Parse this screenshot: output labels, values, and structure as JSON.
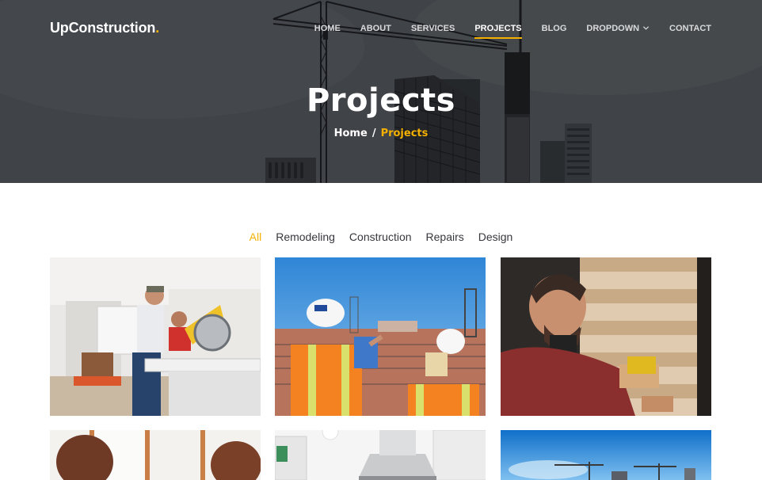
{
  "brand": {
    "name": "UpConstruction",
    "dot": ".",
    "accent_color": "#f5b100"
  },
  "nav": {
    "items": [
      {
        "label": "Home",
        "active": false
      },
      {
        "label": "About",
        "active": false
      },
      {
        "label": "Services",
        "active": false
      },
      {
        "label": "Projects",
        "active": true
      },
      {
        "label": "Blog",
        "active": false
      },
      {
        "label": "Dropdown",
        "active": false,
        "has_menu": true
      },
      {
        "label": "Contact",
        "active": false
      }
    ]
  },
  "hero": {
    "title": "Projects",
    "breadcrumb": {
      "home": "Home",
      "separator": "/",
      "current": "Projects"
    }
  },
  "filters": {
    "items": [
      {
        "label": "All",
        "active": true
      },
      {
        "label": "Remodeling",
        "active": false
      },
      {
        "label": "Construction",
        "active": false
      },
      {
        "label": "Repairs",
        "active": false
      },
      {
        "label": "Design",
        "active": false
      }
    ]
  },
  "projects": [
    {
      "image": "workers-miter-saw-photo"
    },
    {
      "image": "engineers-hardhats-site-photo"
    },
    {
      "image": "man-drilling-log-wall-photo"
    },
    {
      "image": "women-by-window-photo"
    },
    {
      "image": "kitchen-range-hood-photo"
    },
    {
      "image": "cranes-blue-sky-photo"
    }
  ]
}
